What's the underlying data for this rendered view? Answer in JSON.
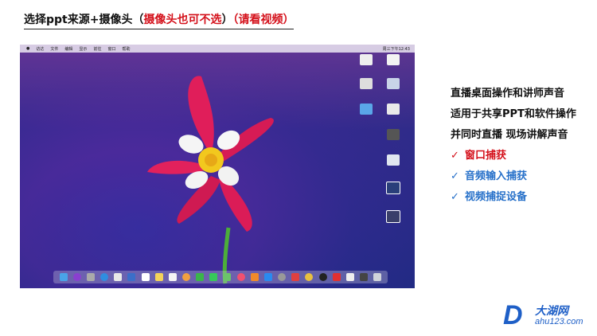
{
  "title": {
    "main": "选择ppt来源+摄像头（",
    "red": "摄像头也可不选",
    "close": "）",
    "hint": "（请看视频）"
  },
  "desktop": {
    "menubar": {
      "items": [
        "访达",
        "文件",
        "编辑",
        "显示",
        "前往",
        "窗口",
        "帮助"
      ],
      "clock": "周三下午12:43"
    }
  },
  "features": [
    {
      "check": "",
      "text": "直播桌面操作和讲师声音",
      "style": "normal"
    },
    {
      "check": "",
      "text": "适用于共享PPT和软件操作",
      "style": "normal"
    },
    {
      "check": "",
      "text": "并同时直播 现场讲解声音",
      "style": "normal"
    },
    {
      "check": "✓",
      "text": "窗口捕获",
      "style": "red"
    },
    {
      "check": "✓",
      "text": "音频输入捕获",
      "style": "blue"
    },
    {
      "check": "✓",
      "text": "视频捕捉设备",
      "style": "blue"
    }
  ],
  "watermark": {
    "logo_letter": "D",
    "name": "大湖网",
    "url": "ahu123.com"
  },
  "colors": {
    "accent_red": "#d4101a",
    "accent_blue": "#2670c9"
  }
}
